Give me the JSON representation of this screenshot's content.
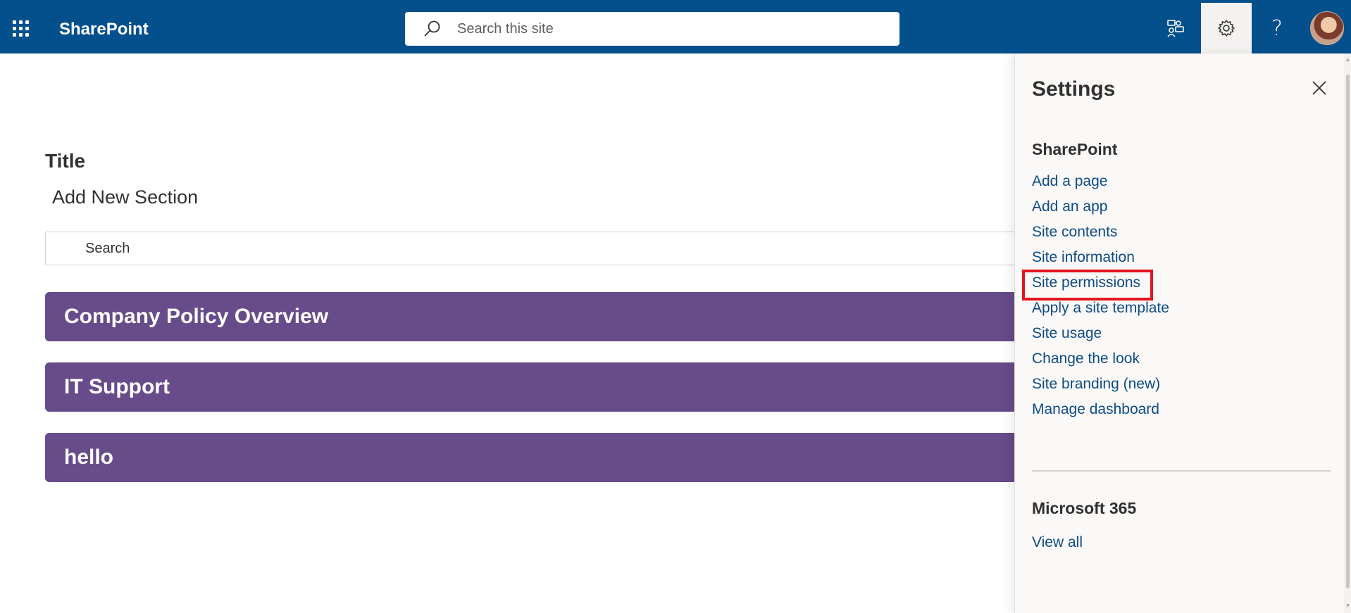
{
  "topbar": {
    "brand": "SharePoint",
    "search_placeholder": "Search this site",
    "icons": [
      "waffle-icon",
      "search-icon",
      "feedback-icon",
      "gear-icon",
      "help-icon",
      "avatar"
    ],
    "help_glyph": "?",
    "bar_color": "#03508d"
  },
  "main": {
    "title": "Title",
    "add_section": "Add New Section",
    "search_placeholder": "Search",
    "sections": [
      "Company Policy Overview",
      "IT Support",
      "hello"
    ],
    "section_color": "#674b8a"
  },
  "settings_panel": {
    "title": "Settings",
    "sharepoint_heading": "SharePoint",
    "links": [
      "Add a page",
      "Add an app",
      "Site contents",
      "Site information",
      "Site permissions",
      "Apply a site template",
      "Site usage",
      "Change the look",
      "Site branding (new)",
      "Manage dashboard"
    ],
    "highlighted_link": "Site permissions",
    "highlight_color": "#e3161c",
    "m365_heading": "Microsoft 365",
    "view_all": "View all"
  }
}
